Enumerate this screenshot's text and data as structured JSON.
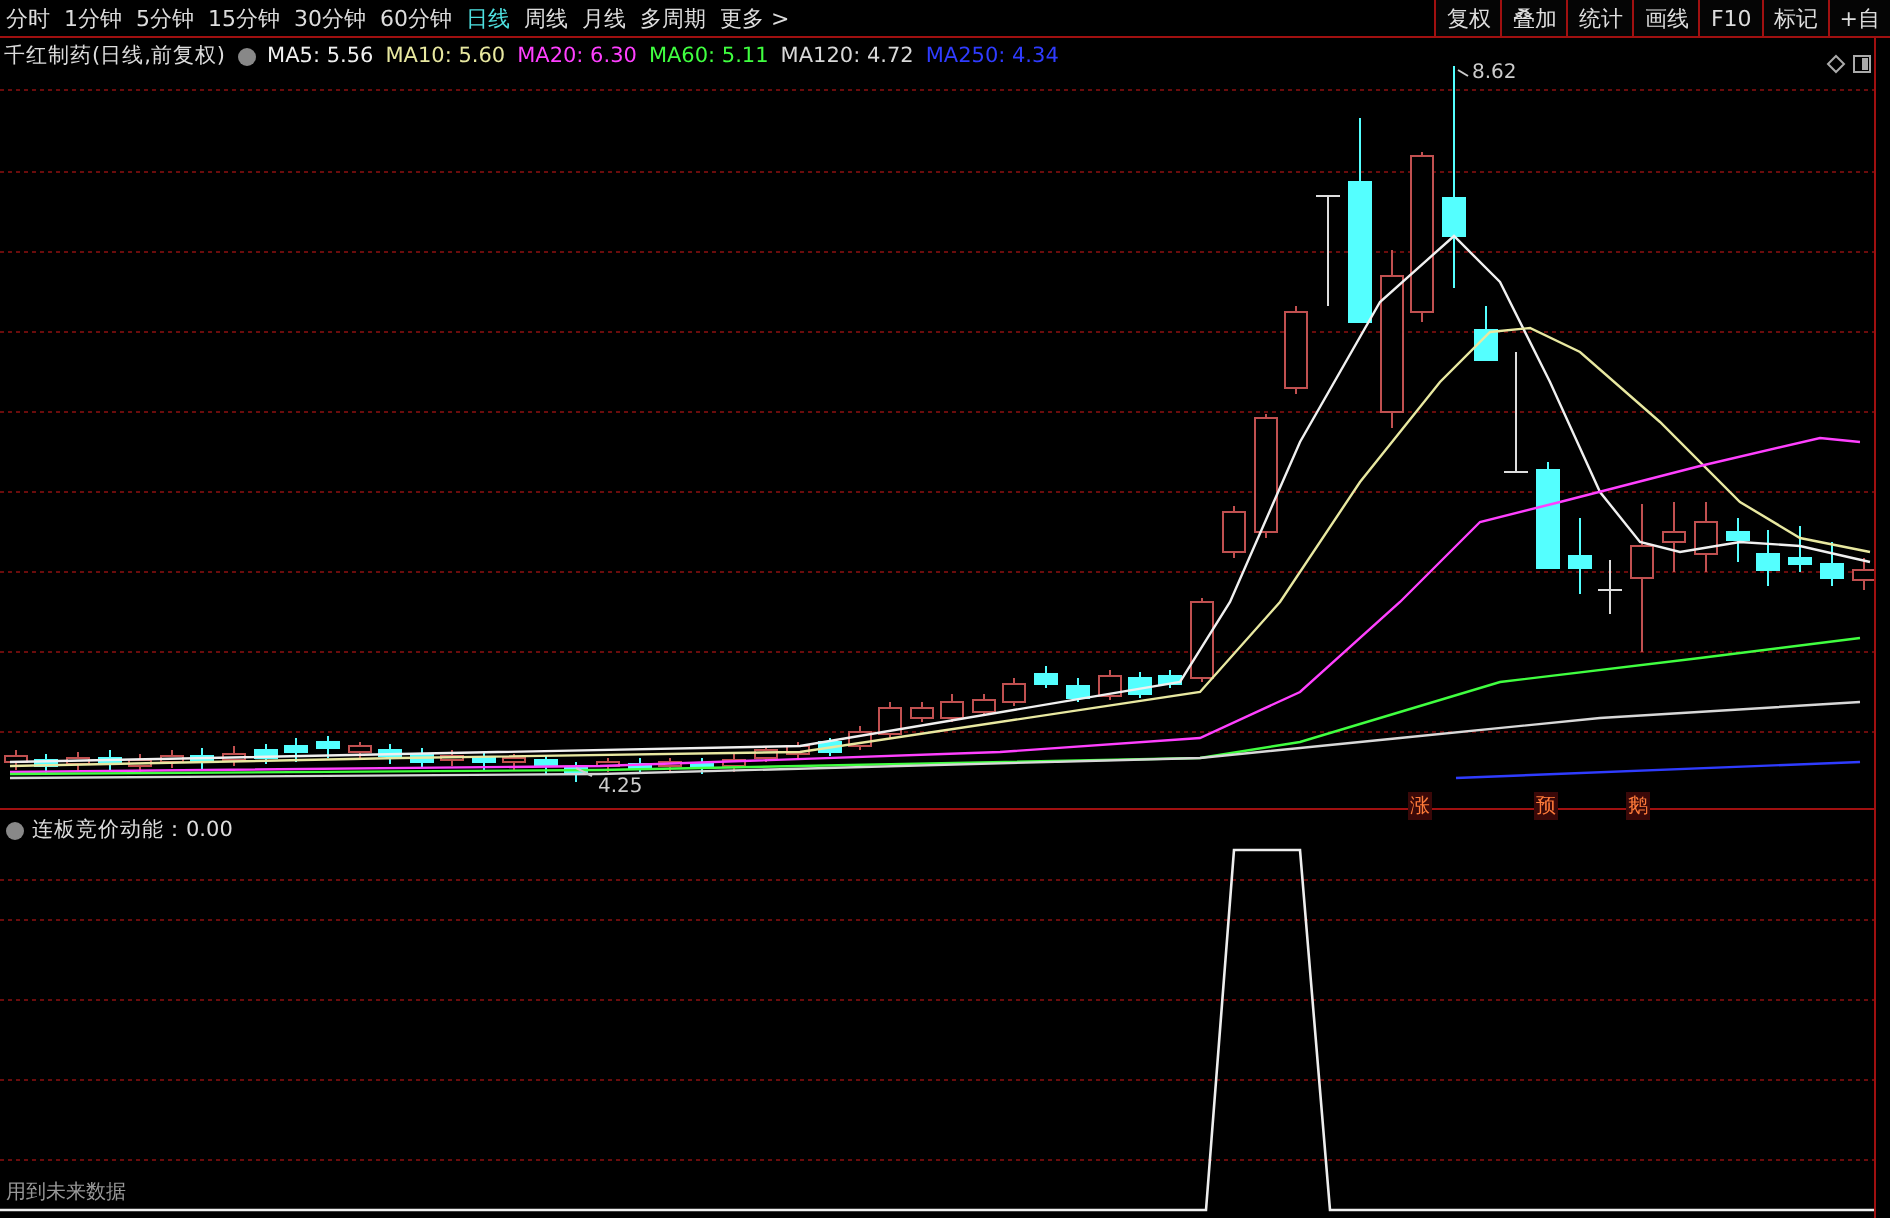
{
  "toolbar": {
    "periods": [
      {
        "label": "分时",
        "selected": false
      },
      {
        "label": "1分钟",
        "selected": false
      },
      {
        "label": "5分钟",
        "selected": false
      },
      {
        "label": "15分钟",
        "selected": false
      },
      {
        "label": "30分钟",
        "selected": false
      },
      {
        "label": "60分钟",
        "selected": false
      },
      {
        "label": "日线",
        "selected": true
      },
      {
        "label": "周线",
        "selected": false
      },
      {
        "label": "月线",
        "selected": false
      },
      {
        "label": "多周期",
        "selected": false
      }
    ],
    "more": "更多 >",
    "buttons": [
      "复权",
      "叠加",
      "统计",
      "画线",
      "F10",
      "标记",
      "+自"
    ]
  },
  "main_chart": {
    "title": "千红制药(日线,前复权)",
    "legend": [
      {
        "label": "MA5: 5.56",
        "color": "#f0f0f0"
      },
      {
        "label": "MA10: 5.60",
        "color": "#e8e8a0"
      },
      {
        "label": "MA20: 6.30",
        "color": "#ff40ff"
      },
      {
        "label": "MA60: 5.11",
        "color": "#40ff40"
      },
      {
        "label": "MA120: 4.72",
        "color": "#d8d8d8"
      },
      {
        "label": "MA250: 4.34",
        "color": "#2f3cff"
      }
    ],
    "high_label": "8.62",
    "low_label": "4.25",
    "signals": [
      "涨",
      "预",
      "鹅"
    ]
  },
  "indicator": {
    "title": "连板竞价动能：0.00",
    "note": "用到未来数据"
  }
}
